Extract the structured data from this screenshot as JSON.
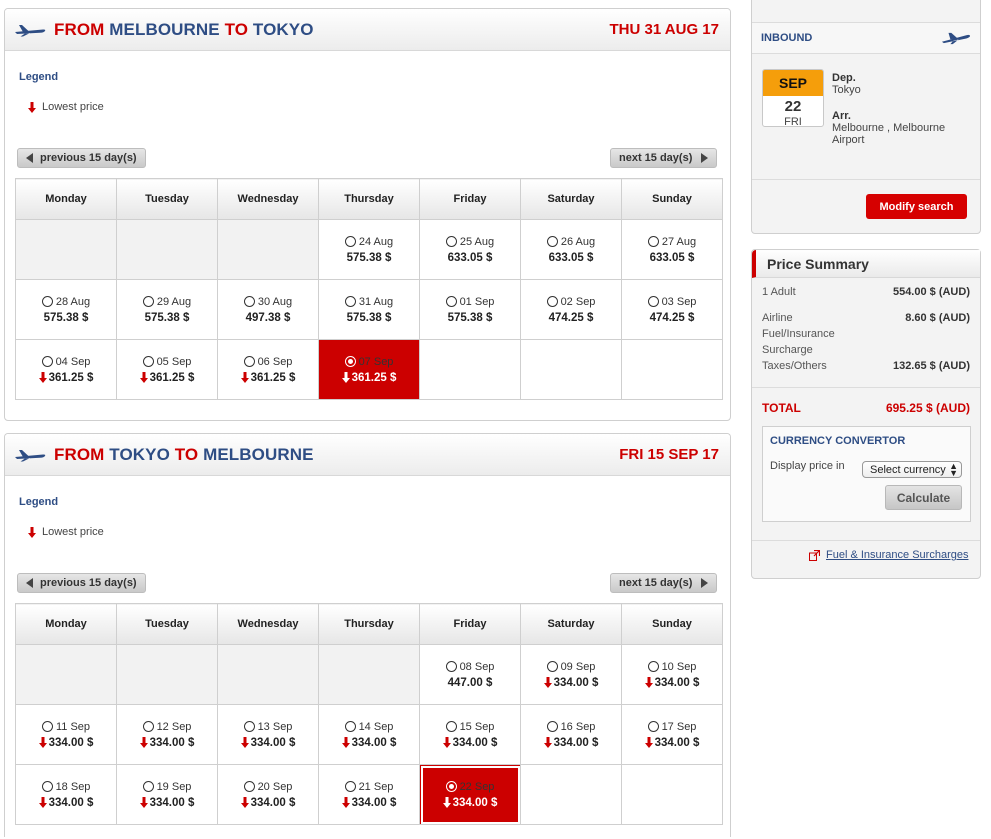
{
  "outbound": {
    "route": {
      "from_kw": "FROM",
      "from_city": "MELBOURNE",
      "to_kw": "TO",
      "to_city": "TOKYO"
    },
    "date": "THU 31 AUG 17",
    "legend": {
      "title": "Legend",
      "lowest": "Lowest price"
    },
    "prev_label": "previous 15 day(s)",
    "next_label": "next 15 day(s)",
    "weekdays": [
      "Monday",
      "Tuesday",
      "Wednesday",
      "Thursday",
      "Friday",
      "Saturday",
      "Sunday"
    ],
    "weeks": [
      [
        null,
        null,
        null,
        {
          "date": "24 Aug",
          "price": "575.38 $"
        },
        {
          "date": "25 Aug",
          "price": "633.05 $"
        },
        {
          "date": "26 Aug",
          "price": "633.05 $"
        },
        {
          "date": "27 Aug",
          "price": "633.05 $"
        }
      ],
      [
        {
          "date": "28 Aug",
          "price": "575.38 $"
        },
        {
          "date": "29 Aug",
          "price": "575.38 $"
        },
        {
          "date": "30 Aug",
          "price": "497.38 $"
        },
        {
          "date": "31 Aug",
          "price": "575.38 $"
        },
        {
          "date": "01 Sep",
          "price": "575.38 $"
        },
        {
          "date": "02 Sep",
          "price": "474.25 $"
        },
        {
          "date": "03 Sep",
          "price": "474.25 $"
        }
      ],
      [
        {
          "date": "04 Sep",
          "price": "361.25 $",
          "lowest": true
        },
        {
          "date": "05 Sep",
          "price": "361.25 $",
          "lowest": true
        },
        {
          "date": "06 Sep",
          "price": "361.25 $",
          "lowest": true
        },
        {
          "date": "07 Sep",
          "price": "361.25 $",
          "lowest": true,
          "selected": true
        },
        "blank",
        "blank",
        "blank"
      ]
    ]
  },
  "return": {
    "route": {
      "from_kw": "FROM",
      "from_city": "TOKYO",
      "to_kw": "TO",
      "to_city": "MELBOURNE"
    },
    "date": "FRI 15 SEP 17",
    "legend": {
      "title": "Legend",
      "lowest": "Lowest price"
    },
    "prev_label": "previous 15 day(s)",
    "next_label": "next 15 day(s)",
    "weekdays": [
      "Monday",
      "Tuesday",
      "Wednesday",
      "Thursday",
      "Friday",
      "Saturday",
      "Sunday"
    ],
    "weeks": [
      [
        null,
        null,
        null,
        null,
        {
          "date": "08 Sep",
          "price": "447.00 $"
        },
        {
          "date": "09 Sep",
          "price": "334.00 $",
          "lowest": true
        },
        {
          "date": "10 Sep",
          "price": "334.00 $",
          "lowest": true
        }
      ],
      [
        {
          "date": "11 Sep",
          "price": "334.00 $",
          "lowest": true
        },
        {
          "date": "12 Sep",
          "price": "334.00 $",
          "lowest": true
        },
        {
          "date": "13 Sep",
          "price": "334.00 $",
          "lowest": true
        },
        {
          "date": "14 Sep",
          "price": "334.00 $",
          "lowest": true
        },
        {
          "date": "15 Sep",
          "price": "334.00 $",
          "lowest": true
        },
        {
          "date": "16 Sep",
          "price": "334.00 $",
          "lowest": true
        },
        {
          "date": "17 Sep",
          "price": "334.00 $",
          "lowest": true
        }
      ],
      [
        {
          "date": "18 Sep",
          "price": "334.00 $",
          "lowest": true
        },
        {
          "date": "19 Sep",
          "price": "334.00 $",
          "lowest": true
        },
        {
          "date": "20 Sep",
          "price": "334.00 $",
          "lowest": true
        },
        {
          "date": "21 Sep",
          "price": "334.00 $",
          "lowest": true
        },
        {
          "date": "22 Sep",
          "price": "334.00 $",
          "lowest": true,
          "selected": true
        },
        "blank",
        "blank"
      ]
    ]
  },
  "inbound": {
    "title": "INBOUND",
    "month": "SEP",
    "day": "22",
    "weekday": "FRI",
    "dep_label": "Dep.",
    "dep_city": "Tokyo",
    "arr_label": "Arr.",
    "arr_city": "Melbourne , Melbourne",
    "arr_airport": "Airport",
    "modify_label": "Modify search"
  },
  "price_summary": {
    "title": "Price Summary",
    "adult_label": "1 Adult",
    "adult_value": "554.00 $ (AUD)",
    "fuel_label_1": "Airline",
    "fuel_label_2": "Fuel/Insurance",
    "fuel_label_3": "Surcharge",
    "fuel_value": "8.60 $ (AUD)",
    "taxes_label": "Taxes/Others",
    "taxes_value": "132.65 $ (AUD)",
    "total_label": "TOTAL",
    "total_value": "695.25 $ (AUD)",
    "converter": {
      "title": "CURRENCY CONVERTOR",
      "display_label": "Display price in",
      "select_value": "Select currency",
      "calculate_label": "Calculate"
    },
    "fuel_link": "Fuel & Insurance Surcharges"
  },
  "colors": {
    "accent_red": "#cc0000",
    "brand_blue": "#2e4d84",
    "badge_orange": "#f59e0b"
  },
  "icons": {
    "plane": "airplane-icon",
    "arrow": "arrow-down-icon",
    "external": "external-link-icon"
  }
}
